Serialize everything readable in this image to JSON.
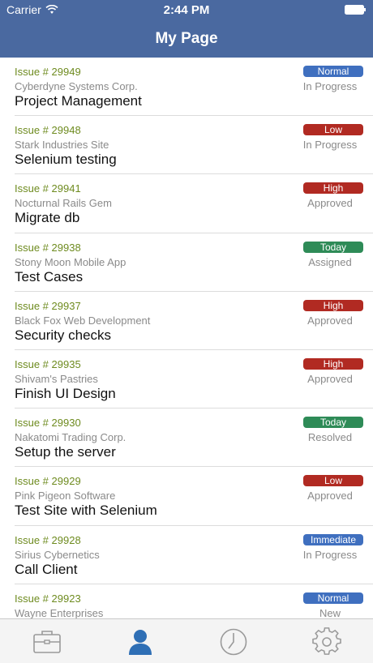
{
  "status_bar": {
    "carrier": "Carrier",
    "time": "2:44 PM"
  },
  "nav": {
    "title": "My Page"
  },
  "colors": {
    "header": "#4a69a0",
    "normal": "#3f6fbf",
    "low": "#b12a22",
    "high": "#b12a22",
    "today": "#2e8b57",
    "immediate": "#3f6fbf",
    "issue_text": "#6e8b1f"
  },
  "issues": [
    {
      "issue": "Issue # 29949",
      "company": "Cyberdyne Systems Corp.",
      "title": "Project Management",
      "priority": "Normal",
      "status": "In Progress",
      "color": "#3f6fbf"
    },
    {
      "issue": "Issue # 29948",
      "company": "Stark Industries Site",
      "title": "Selenium testing",
      "priority": "Low",
      "status": "In Progress",
      "color": "#b12a22"
    },
    {
      "issue": "Issue # 29941",
      "company": "Nocturnal Rails Gem",
      "title": "Migrate db",
      "priority": "High",
      "status": "Approved",
      "color": "#b12a22"
    },
    {
      "issue": "Issue # 29938",
      "company": "Stony Moon Mobile App",
      "title": "Test Cases",
      "priority": "Today",
      "status": "Assigned",
      "color": "#2e8b57"
    },
    {
      "issue": "Issue # 29937",
      "company": "Black Fox Web Development",
      "title": "Security checks",
      "priority": "High",
      "status": "Approved",
      "color": "#b12a22"
    },
    {
      "issue": "Issue # 29935",
      "company": "Shivam's Pastries",
      "title": "Finish UI Design",
      "priority": "High",
      "status": "Approved",
      "color": "#b12a22"
    },
    {
      "issue": "Issue # 29930",
      "company": "Nakatomi Trading Corp.",
      "title": "Setup the server",
      "priority": "Today",
      "status": "Resolved",
      "color": "#2e8b57"
    },
    {
      "issue": "Issue # 29929",
      "company": "Pink Pigeon Software",
      "title": "Test Site with Selenium",
      "priority": "Low",
      "status": "Approved",
      "color": "#b12a22"
    },
    {
      "issue": "Issue # 29928",
      "company": "Sirius Cybernetics",
      "title": "Call Client",
      "priority": "Immediate",
      "status": "In Progress",
      "color": "#3f6fbf"
    },
    {
      "issue": "Issue # 29923",
      "company": "Wayne Enterprises",
      "title": "",
      "priority": "Normal",
      "status": "New",
      "color": "#3f6fbf"
    }
  ],
  "tabs": [
    {
      "icon": "briefcase-icon",
      "active": false
    },
    {
      "icon": "person-icon",
      "active": true
    },
    {
      "icon": "clock-icon",
      "active": false
    },
    {
      "icon": "gear-icon",
      "active": false
    }
  ]
}
